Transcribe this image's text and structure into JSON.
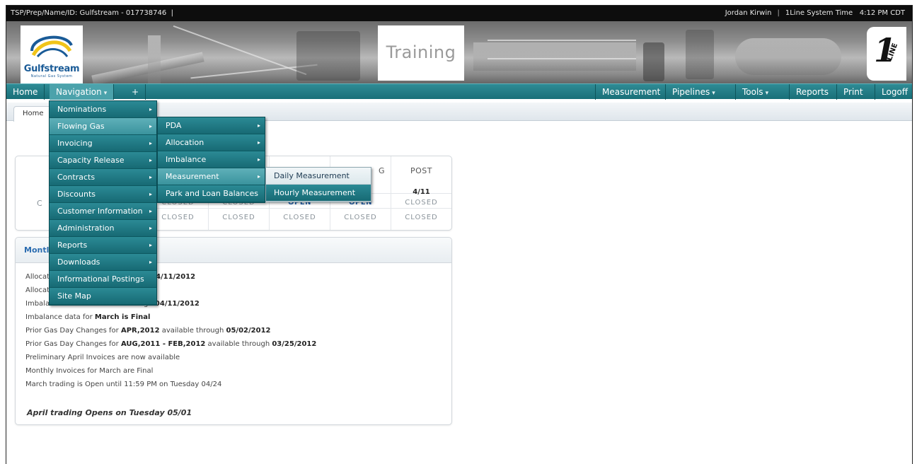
{
  "topbar": {
    "tsp": "TSP/Prep/Name/ID: Gulfstream - 017738746",
    "tsp_sep": "|",
    "user": "Jordan Kirwin",
    "sep": "|",
    "system_time_label": "1Line System Time",
    "system_time": "4:12 PM CDT"
  },
  "banner": {
    "logo_name": "Gulfstream",
    "logo_tagline": "Natural Gas System",
    "environment": "Training",
    "product_logo_number": "1",
    "product_logo_text": "LINE"
  },
  "nav": {
    "home": "Home",
    "navigation": "Navigation",
    "add": "+",
    "measurement": "Measurement",
    "pipelines": "Pipelines",
    "tools": "Tools",
    "reports": "Reports",
    "print": "Print",
    "logoff": "Logoff",
    "caret": "▾"
  },
  "breadcrumb": {
    "home_tab": "Home"
  },
  "menus": {
    "main": [
      "Nominations",
      "Flowing Gas",
      "Invoicing",
      "Capacity Release",
      "Contracts",
      "Discounts",
      "Customer Information",
      "Administration",
      "Reports",
      "Downloads",
      "Informational Postings",
      "Site Map"
    ],
    "flowing_gas": [
      "PDA",
      "Allocation",
      "Imbalance",
      "Measurement",
      "Park and Loan Balances"
    ],
    "measurement": [
      "Daily Measurement",
      "Hourly Measurement"
    ],
    "arrow": "▸"
  },
  "schedule": {
    "partial_header": "G",
    "columns": [
      {
        "header": "",
        "date": "",
        "row1": "CLOSED",
        "row2": "CLOSED"
      },
      {
        "header": "",
        "date": "",
        "row1": "CLOSED",
        "row2": "CLOSED"
      },
      {
        "header": "",
        "date": "",
        "row1": "OPEN",
        "row2": "CLOSED"
      },
      {
        "header": "",
        "date": "",
        "row1": "OPEN",
        "row2": "CLOSED"
      },
      {
        "header": "POST",
        "date": "4/11",
        "row1": "CLOSED",
        "row2": "CLOSED"
      }
    ],
    "left_fragment": "C"
  },
  "monthly": {
    "title_fragment": "Montl",
    "line1_prefix": "Allocat",
    "line1_date": "4/11/2012",
    "line2_prefix": "Allocat",
    "line3_pre": "Imbalance data is available through ",
    "line3_date": "04/11/2012",
    "line4_pre": "Imbalance data for ",
    "line4_bold": "March is Final",
    "line5_pre": "Prior Gas Day Changes for ",
    "line5_bold1": "APR,2012",
    "line5_mid": " available through ",
    "line5_bold2": "05/02/2012",
    "line6_pre": "Prior Gas Day Changes for ",
    "line6_bold1": "AUG,2011 - FEB,2012",
    "line6_mid": " available through ",
    "line6_bold2": "03/25/2012",
    "line7": "Preliminary April Invoices are now available",
    "line8": "Monthly Invoices for March are Final",
    "line9": "March trading is Open until 11:59 PM on Tuesday 04/24",
    "footer": "April trading Opens on Tuesday 05/01"
  }
}
